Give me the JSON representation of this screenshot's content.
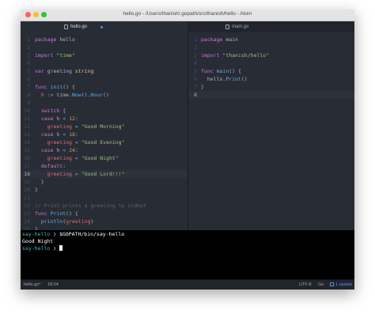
{
  "window": {
    "title": "hello.go - /Users/thanish/.gopath/src/thanish/hello - Atom"
  },
  "tabs": [
    {
      "label": "hello.go",
      "active": true,
      "modified": true
    },
    {
      "label": "main.go",
      "active": false,
      "modified": false
    }
  ],
  "editor_left": {
    "file": "hello.go",
    "current_line": 18,
    "lines": [
      {
        "n": "1",
        "segs": [
          [
            "package",
            "kw"
          ],
          [
            " hello",
            "id"
          ]
        ]
      },
      {
        "n": "2",
        "segs": []
      },
      {
        "n": "3",
        "segs": [
          [
            "import",
            "kw"
          ],
          [
            " ",
            ""
          ],
          [
            "\"time\"",
            "str"
          ]
        ]
      },
      {
        "n": "4",
        "segs": []
      },
      {
        "n": "5",
        "segs": [
          [
            "var",
            "kw"
          ],
          [
            " greeting ",
            "id"
          ],
          [
            "string",
            "type"
          ]
        ]
      },
      {
        "n": "6",
        "segs": []
      },
      {
        "n": "7",
        "segs": [
          [
            "func",
            "kw"
          ],
          [
            " ",
            ""
          ],
          [
            "init",
            "fn"
          ],
          [
            "() {",
            "id"
          ]
        ]
      },
      {
        "n": "8",
        "segs": [
          [
            "  h ",
            "var"
          ],
          [
            ":=",
            "op"
          ],
          [
            " time.",
            ""
          ],
          [
            "Now",
            "fn"
          ],
          [
            "().",
            ""
          ],
          [
            "Hour",
            "fn"
          ],
          [
            "()",
            ""
          ]
        ]
      },
      {
        "n": "9",
        "segs": []
      },
      {
        "n": "10",
        "segs": [
          [
            "  ",
            ""
          ],
          [
            "switch",
            "kw"
          ],
          [
            " {",
            ""
          ]
        ]
      },
      {
        "n": "11",
        "segs": [
          [
            "  ",
            ""
          ],
          [
            "case",
            "kw"
          ],
          [
            " h ",
            ""
          ],
          [
            "<",
            "op"
          ],
          [
            " ",
            ""
          ],
          [
            "12",
            "num"
          ],
          [
            ":",
            ""
          ]
        ]
      },
      {
        "n": "12",
        "segs": [
          [
            "    greeting ",
            "var"
          ],
          [
            "=",
            "op"
          ],
          [
            " ",
            ""
          ],
          [
            "\"Good Morning\"",
            "str"
          ]
        ]
      },
      {
        "n": "13",
        "segs": [
          [
            "  ",
            ""
          ],
          [
            "case",
            "kw"
          ],
          [
            " h ",
            ""
          ],
          [
            "<",
            "op"
          ],
          [
            " ",
            ""
          ],
          [
            "18",
            "num"
          ],
          [
            ":",
            ""
          ]
        ]
      },
      {
        "n": "14",
        "segs": [
          [
            "    greeting ",
            "var"
          ],
          [
            "=",
            "op"
          ],
          [
            " ",
            ""
          ],
          [
            "\"Good Evening\"",
            "str"
          ]
        ]
      },
      {
        "n": "15",
        "segs": [
          [
            "  ",
            ""
          ],
          [
            "case",
            "kw"
          ],
          [
            " h ",
            ""
          ],
          [
            "<",
            "op"
          ],
          [
            " ",
            ""
          ],
          [
            "24",
            "num"
          ],
          [
            ":",
            ""
          ]
        ]
      },
      {
        "n": "16",
        "segs": [
          [
            "    greeting ",
            "var"
          ],
          [
            "=",
            "op"
          ],
          [
            " ",
            ""
          ],
          [
            "\"Good Night\"",
            "str"
          ]
        ]
      },
      {
        "n": "17",
        "segs": [
          [
            "  ",
            ""
          ],
          [
            "default",
            "kw"
          ],
          [
            ":",
            ""
          ]
        ]
      },
      {
        "n": "18",
        "segs": [
          [
            "    greeting ",
            "var"
          ],
          [
            "=",
            "op"
          ],
          [
            " ",
            ""
          ],
          [
            "\"Good Lord!!!\"",
            "str"
          ]
        ]
      },
      {
        "n": "19",
        "segs": [
          [
            "  }",
            ""
          ]
        ]
      },
      {
        "n": "20",
        "segs": [
          [
            "}",
            ""
          ]
        ]
      },
      {
        "n": "21",
        "segs": []
      },
      {
        "n": "22",
        "segs": [
          [
            "// Print prints a greeting to stdout",
            "cmt"
          ]
        ]
      },
      {
        "n": "23",
        "segs": [
          [
            "func",
            "kw"
          ],
          [
            " ",
            ""
          ],
          [
            "Print",
            "fn"
          ],
          [
            "() {",
            ""
          ]
        ]
      },
      {
        "n": "24",
        "segs": [
          [
            "  ",
            ""
          ],
          [
            "println",
            "fn"
          ],
          [
            "(",
            ""
          ],
          [
            "greeting",
            "var"
          ],
          [
            ")",
            ""
          ]
        ]
      },
      {
        "n": "25",
        "segs": [
          [
            "}",
            ""
          ]
        ]
      },
      {
        "n": "26",
        "segs": []
      }
    ]
  },
  "editor_right": {
    "file": "main.go",
    "current_line": 8,
    "lines": [
      {
        "n": "1",
        "segs": [
          [
            "package",
            "kw"
          ],
          [
            " main",
            ""
          ]
        ]
      },
      {
        "n": "2",
        "segs": []
      },
      {
        "n": "3",
        "segs": [
          [
            "import",
            "kw"
          ],
          [
            " ",
            ""
          ],
          [
            "\"thanish/hello\"",
            "str"
          ]
        ]
      },
      {
        "n": "4",
        "segs": []
      },
      {
        "n": "5",
        "segs": [
          [
            "func",
            "kw"
          ],
          [
            " ",
            ""
          ],
          [
            "main",
            "fn"
          ],
          [
            "() {",
            ""
          ]
        ]
      },
      {
        "n": "6",
        "segs": [
          [
            "  hello.",
            ""
          ],
          [
            "Print",
            "fn"
          ],
          [
            "()",
            ""
          ]
        ]
      },
      {
        "n": "7",
        "segs": [
          [
            "}",
            ""
          ]
        ]
      },
      {
        "n": "8",
        "segs": []
      }
    ]
  },
  "terminal": {
    "lines": [
      {
        "prompt": "say-hello",
        "arrow": "❯",
        "text": " $GOPATH/bin/say-hello"
      },
      {
        "prompt": "",
        "arrow": "",
        "text": "Good Night"
      },
      {
        "prompt": "say-hello",
        "arrow": "❯",
        "text": " "
      }
    ]
  },
  "statusbar": {
    "file": "hello.go*",
    "position": "18:24",
    "encoding": "UTF-8",
    "grammar": "Go",
    "update": "1 update"
  },
  "colors": {
    "kw": "#c678dd",
    "str": "#98c379",
    "fn": "#61afef",
    "type": "#e5c07b",
    "num": "#d19a66",
    "var": "#e06c75",
    "op": "#56b6c2",
    "cmt": "#5c6370",
    "id": "#abb2bf",
    "prompt": "#56b6c2",
    "arrow": "#c678dd"
  }
}
